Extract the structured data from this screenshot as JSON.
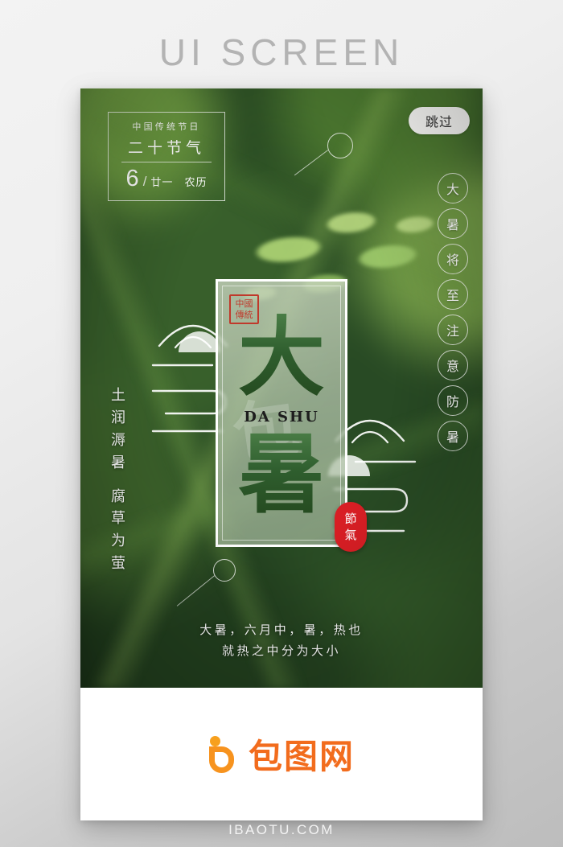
{
  "page": {
    "title": "UI SCREEN",
    "watermark": "IBAOTU.COM"
  },
  "screen": {
    "skip_button": "跳过",
    "date_box": {
      "festival_line": "中国传统节日",
      "solar_terms": "二十节气",
      "month": "6",
      "slash": "/",
      "lunar_day": "廿一",
      "lunar_label": "农历"
    },
    "right_circle_chars": [
      "大",
      "暑",
      "将",
      "至",
      "注",
      "意",
      "防",
      "暑"
    ],
    "left_poem": {
      "group1": [
        "土",
        "润",
        "溽",
        "暑"
      ],
      "group2": [
        "腐",
        "草",
        "为",
        "萤"
      ]
    },
    "card": {
      "seal_top": "中國",
      "seal_bottom": "傳統",
      "glyph_top": "大",
      "pinyin": "DA SHU",
      "glyph_bottom": "暑",
      "watermark_glyph": "包"
    },
    "jieqi_badge": {
      "char_top": "節",
      "char_bottom": "氣"
    },
    "caption": {
      "line1": "大暑，六月中，暑，热也",
      "line2": "就热之中分为大小"
    }
  },
  "footer": {
    "logo_text": "包图网",
    "logo_mark_name": "baotu-b-logo"
  },
  "colors": {
    "accent_orange": "#f26c1d",
    "logo_orange": "#f7931e",
    "seal_red": "#c0392b",
    "badge_red": "#d81e24",
    "card_green": "#2f5e2e",
    "page_title_gray": "#b3b3b3"
  }
}
